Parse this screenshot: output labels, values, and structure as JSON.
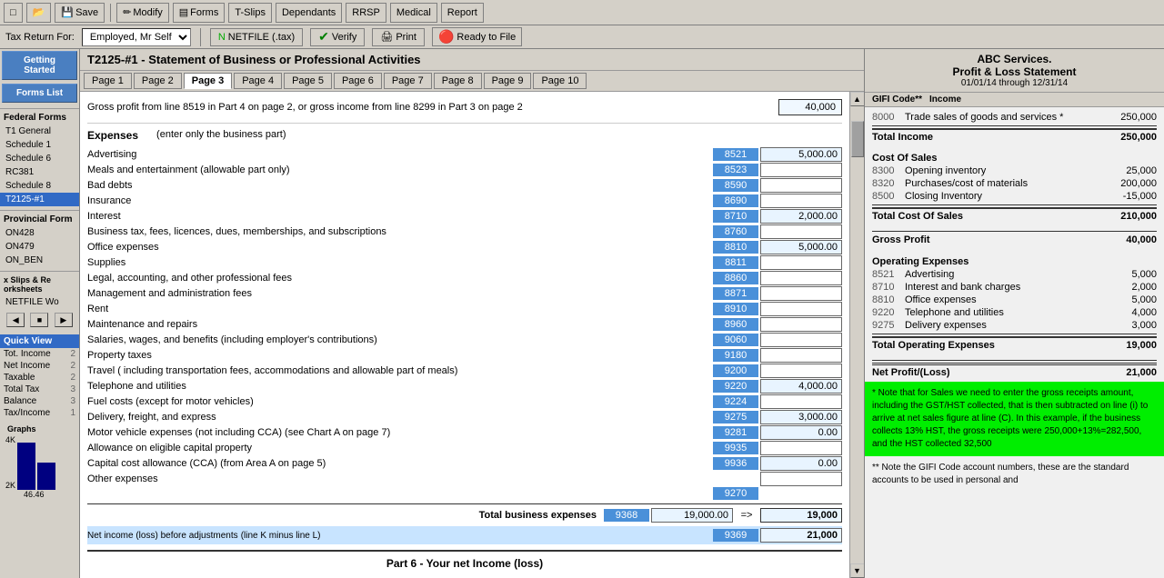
{
  "toolbar": {
    "buttons": [
      "Save",
      "Modify",
      "Forms",
      "T-Slips",
      "Dependants",
      "RRSP",
      "Medical",
      "Report"
    ]
  },
  "navbar": {
    "tax_return_label": "Tax Return For:",
    "taxpayer": "Employed, Mr Self",
    "netfile_label": "NETFILE (.tax)",
    "verify_label": "Verify",
    "print_label": "Print",
    "ready_label": "Ready to File"
  },
  "form": {
    "title": "T2125-#1 - Statement of Business or Professional Activities",
    "tabs": [
      "Page 1",
      "Page 2",
      "Page 3",
      "Page 4",
      "Page 5",
      "Page 6",
      "Page 7",
      "Page 8",
      "Page 9",
      "Page 10"
    ],
    "active_tab": "Page 3",
    "gross_line_text": "Gross profit from line 8519 in Part 4  on page 2, or gross income from line 8299 in Part 3 on page 2",
    "gross_amount": "40,000",
    "expenses_title": "Expenses",
    "expenses_note": "(enter only the business part)",
    "expense_rows": [
      {
        "label": "Advertising",
        "code": "8521",
        "amount": "5,000.00"
      },
      {
        "label": "Meals and entertainment (allowable part only)",
        "code": "8523",
        "amount": ""
      },
      {
        "label": "Bad debts",
        "code": "8590",
        "amount": ""
      },
      {
        "label": "Insurance",
        "code": "8690",
        "amount": ""
      },
      {
        "label": "Interest",
        "code": "8710",
        "amount": "2,000.00"
      },
      {
        "label": "Business tax, fees, licences, dues, memberships, and subscriptions",
        "code": "8760",
        "amount": ""
      },
      {
        "label": "Office expenses",
        "code": "8810",
        "amount": "5,000.00"
      },
      {
        "label": "Supplies",
        "code": "8811",
        "amount": ""
      },
      {
        "label": "Legal, accounting, and other professional fees",
        "code": "8860",
        "amount": ""
      },
      {
        "label": "Management and administration fees",
        "code": "8871",
        "amount": ""
      },
      {
        "label": "Rent",
        "code": "8910",
        "amount": ""
      },
      {
        "label": "Maintenance and repairs",
        "code": "8960",
        "amount": ""
      },
      {
        "label": "Salaries, wages, and benefits (including employer's contributions)",
        "code": "9060",
        "amount": ""
      },
      {
        "label": "Property taxes",
        "code": "9180",
        "amount": ""
      },
      {
        "label": "Travel ( including transportation fees, accommodations and allowable part of meals)",
        "code": "9200",
        "amount": ""
      },
      {
        "label": "Telephone and utilities",
        "code": "9220",
        "amount": "4,000.00"
      },
      {
        "label": "Fuel costs (except for motor vehicles)",
        "code": "9224",
        "amount": ""
      },
      {
        "label": "Delivery, freight, and express",
        "code": "9275",
        "amount": "3,000.00"
      },
      {
        "label": "Motor vehicle expenses (not including CCA) (see Chart A on page 7)",
        "code": "9281",
        "amount": "0.00"
      },
      {
        "label": "Allowance on eligible capital property",
        "code": "9935",
        "amount": ""
      },
      {
        "label": "Capital cost allowance (CCA) (from Area A on page 5)",
        "code": "9936",
        "amount": "0.00"
      },
      {
        "label": "Other expenses",
        "code": "",
        "amount": ""
      }
    ],
    "other_code": "9270",
    "total_code": "9368",
    "total_amount": "19,000.00",
    "total_label": "Total business expenses",
    "arrow": "=>",
    "total_final": "19,000",
    "net_income_label": "Net income (loss) before adjustments",
    "net_income_sub": "(line K minus line L)",
    "net_income_code": "9369",
    "net_income_amount": "21,000",
    "part6_label": "Part 6 - Your net Income (loss)"
  },
  "sidebar": {
    "getting_started": "Getting Started",
    "forms_list": "Forms List",
    "federal_forms": "Federal Forms",
    "items": [
      {
        "label": "T1 General",
        "num": ""
      },
      {
        "label": "Schedule 1",
        "num": ""
      },
      {
        "label": "Schedule 6",
        "num": ""
      },
      {
        "label": "RC381",
        "num": ""
      },
      {
        "label": "Schedule 8",
        "num": ""
      },
      {
        "label": "T2125-#1",
        "num": ""
      }
    ],
    "provincial": "Provincial Form",
    "provincial_items": [
      {
        "label": "ON428",
        "num": ""
      },
      {
        "label": "ON479",
        "num": ""
      },
      {
        "label": "ON_BEN",
        "num": ""
      }
    ],
    "worksheets": "x Slips & Re orksheets",
    "netfile": "NETFILE Wo",
    "quick_view": "Quick View",
    "qv_items": [
      {
        "label": "Tot. Income",
        "num": "2"
      },
      {
        "label": "Net Income",
        "num": "2"
      },
      {
        "label": "Taxable",
        "num": "2"
      },
      {
        "label": "Total Tax",
        "num": "3"
      },
      {
        "label": "Balance",
        "num": "3"
      },
      {
        "label": "Tax/Income",
        "num": "1"
      }
    ],
    "graphs_label": "Graphs",
    "graph_y1": "4K",
    "graph_y2": "2K",
    "graph_val": "46.46"
  },
  "right_panel": {
    "company": "ABC Services.",
    "title": "Profit & Loss Statement",
    "period": "01/01/14 through  12/31/14",
    "gifi_col": "GIFI Code**",
    "income_col": "Income",
    "income_section": {
      "rows": [
        {
          "code": "8000",
          "label": "Trade sales of goods and services *",
          "val": "250,000"
        },
        {
          "label": "Total Income",
          "val": "250,000",
          "bold": true
        }
      ]
    },
    "cost_section": {
      "title": "Cost Of Sales",
      "rows": [
        {
          "code": "8300",
          "label": "Opening inventory",
          "val": "25,000"
        },
        {
          "code": "8320",
          "label": "Purchases/cost of materials",
          "val": "200,000"
        },
        {
          "code": "8500",
          "label": "Closing Inventory",
          "val": "-15,000"
        },
        {
          "label": "Total Cost Of Sales",
          "val": "210,000",
          "bold": true
        }
      ]
    },
    "gross_profit": {
      "label": "Gross Profit",
      "val": "40,000"
    },
    "operating_section": {
      "title": "Operating Expenses",
      "rows": [
        {
          "code": "8521",
          "label": "Advertising",
          "val": "5,000"
        },
        {
          "code": "8710",
          "label": "Interest and bank charges",
          "val": "2,000"
        },
        {
          "code": "8810",
          "label": "Office expenses",
          "val": "5,000"
        },
        {
          "code": "9220",
          "label": "Telephone and utilities",
          "val": "4,000"
        },
        {
          "code": "9275",
          "label": "Delivery expenses",
          "val": "3,000"
        },
        {
          "label": "Total Operating Expenses",
          "val": "19,000",
          "bold": true
        }
      ]
    },
    "net_profit": {
      "label": "Net Profit/(Loss)",
      "val": "21,000"
    },
    "note_green": "* Note that for Sales we need to enter the gross receipts amount, including the GST/HST collected, that is then subtracted on line (i) to arrive at net sales figure at line (C). In this example, if the business collects 13% HST, the gross receipts were 250,000+13%=282,500, and the HST collected 32,500",
    "note_white": "** Note the GIFI Code account numbers, these are the standard accounts to be used in personal and"
  }
}
